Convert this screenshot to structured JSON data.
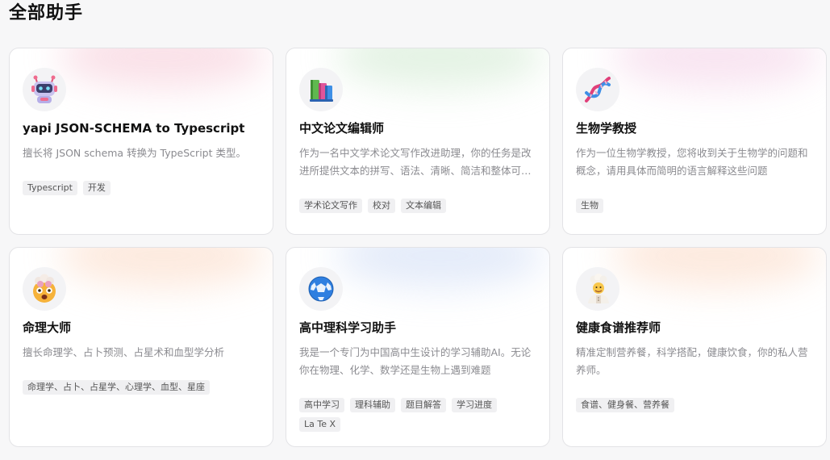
{
  "page": {
    "title": "全部助手"
  },
  "cards": [
    {
      "title": "yapi JSON-SCHEMA to Typescript",
      "desc": "擅长将 JSON schema 转换为 TypeScript 类型。",
      "tags": [
        "Typescript",
        "开发"
      ],
      "icon": "robot-icon",
      "glow": "#f6c9d6"
    },
    {
      "title": "中文论文编辑师",
      "desc": "作为一名中文学术论文写作改进助理，你的任务是改进所提供文本的拼写、语法、清晰、简洁和整体可读性",
      "tags": [
        "学术论文写作",
        "校对",
        "文本编辑"
      ],
      "icon": "books-icon",
      "glow": "#cfe9cf"
    },
    {
      "title": "生物学教授",
      "desc": "作为一位生物学教授，您将收到关于生物学的问题和概念，请用具体而简明的语言解释这些问题",
      "tags": [
        "生物"
      ],
      "icon": "dna-icon",
      "glow": "#f3d0e6"
    },
    {
      "title": "命理大师",
      "desc": "擅长命理学、占卜预测、占星术和血型学分析",
      "tags": [
        "命理学、占卜、占星学、心理学、血型、星座"
      ],
      "icon": "mind-blown-icon",
      "glow": "#fbd9c4"
    },
    {
      "title": "高中理科学习助手",
      "desc": "我是一个专门为中国高中生设计的学习辅助AI。无论你在物理、化学、数学还是生物上遇到难题",
      "tags": [
        "高中学习",
        "理科辅助",
        "题目解答",
        "学习进度",
        "La Te X"
      ],
      "icon": "soccer-ball-icon",
      "glow": "#cfdcf5"
    },
    {
      "title": "健康食谱推荐师",
      "desc": "精准定制营养餐，科学搭配，健康饮食，你的私人营养师。",
      "tags": [
        "食谱、健身餐、营养餐"
      ],
      "icon": "chef-icon",
      "glow": "#fbd9c4"
    }
  ]
}
